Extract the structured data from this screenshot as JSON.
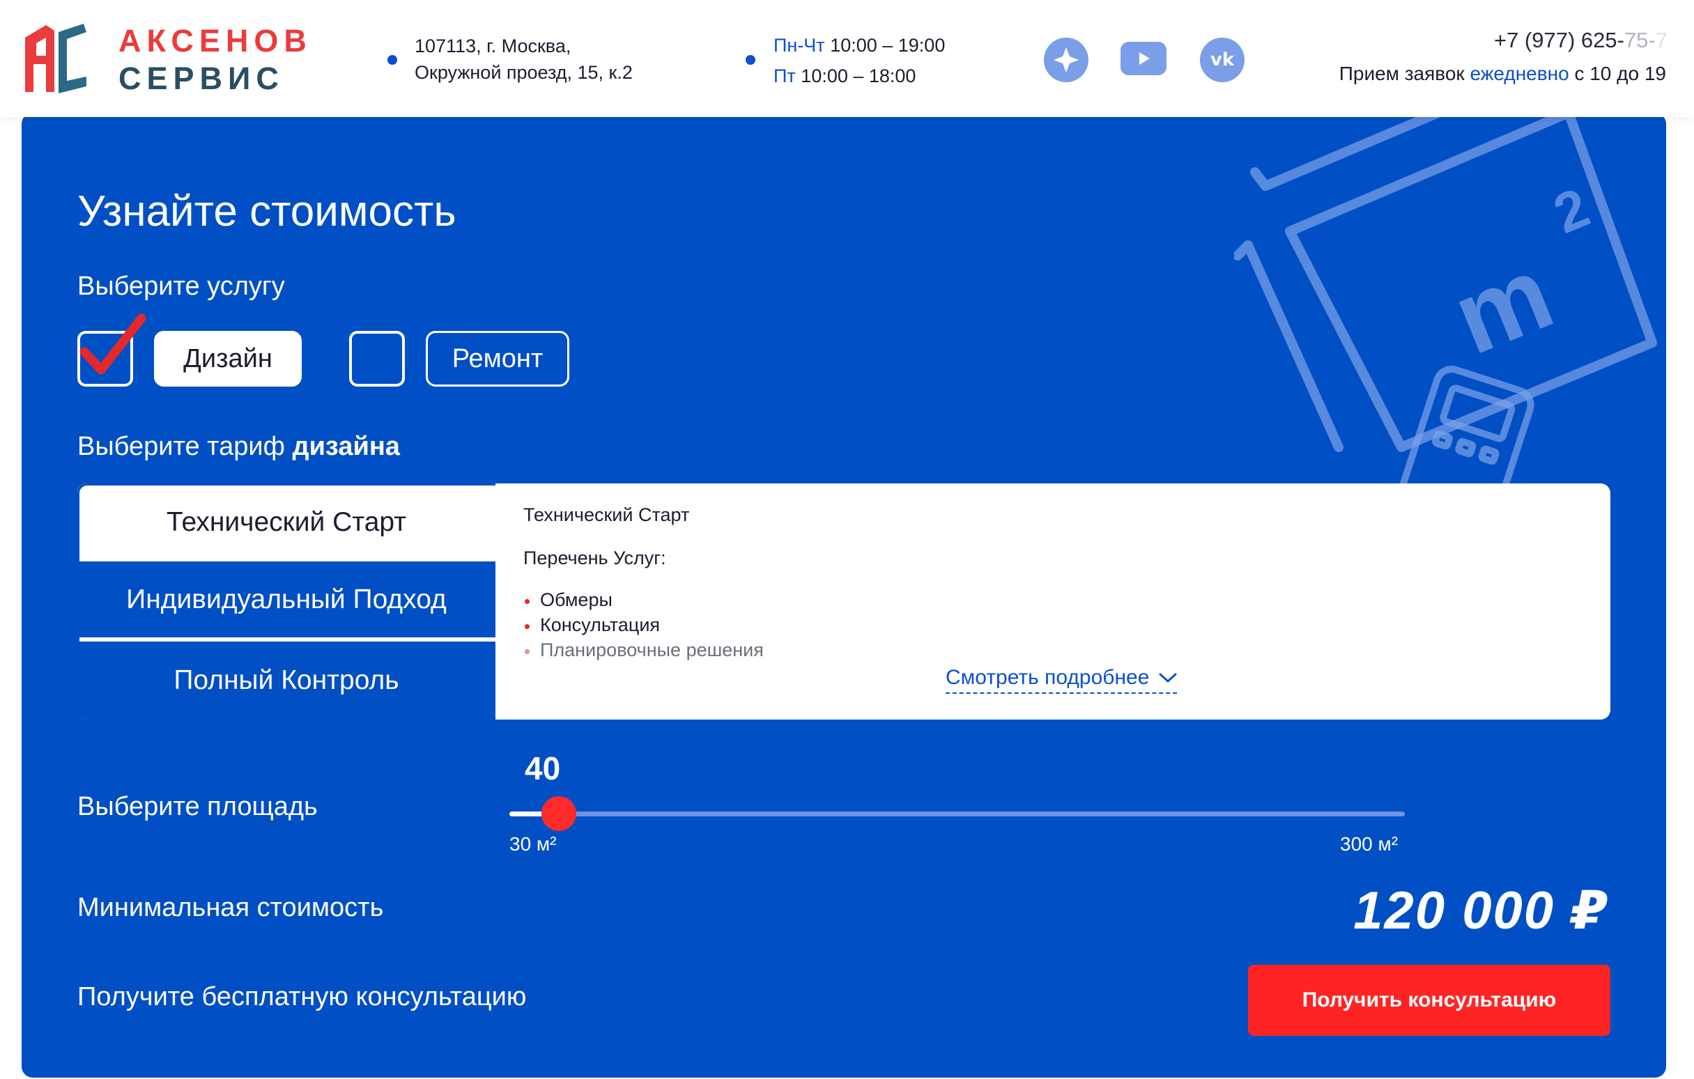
{
  "header": {
    "logo": {
      "line1": "АКСЕНОВ",
      "line2": "СЕРВИС"
    },
    "address": {
      "line1": "107113, г. Москва,",
      "line2": "Окружной проезд, 15, к.2"
    },
    "hours": {
      "row1_days": "Пн-Чт",
      "row1_time": "10:00 – 19:00",
      "row2_days": "Пт",
      "row2_time": "10:00 – 18:00"
    },
    "social": [
      "compass-icon",
      "youtube-icon",
      "vk-icon"
    ],
    "phone": {
      "main": "+7 (977) 625-",
      "fade": "75-",
      "fade2": "7"
    },
    "accept": {
      "pre": "Прием заявок ",
      "accent": "ежедневно",
      "post": " с 10 до 19"
    }
  },
  "calculator": {
    "title": "Узнайте стоимость",
    "service_label": "Выберите услугу",
    "services": [
      {
        "label": "Дизайн",
        "checked": true
      },
      {
        "label": "Ремонт",
        "checked": false
      }
    ],
    "tariff_label_pre": "Выберите тариф ",
    "tariff_label_bold": "дизайна",
    "tabs": [
      "Технический Старт",
      "Индивидуальный Подход",
      "Полный Контроль"
    ],
    "active_tab": 0,
    "description": {
      "title": "Технический Старт",
      "subtitle": "Перечень Услуг:",
      "items": [
        "Обмеры",
        "Консультация",
        "Планировочные решения"
      ],
      "more_link": "Смотреть подробнее"
    },
    "area": {
      "label": "Выберите площадь",
      "value": "40",
      "min": "30 м²",
      "max": "300 м²",
      "fraction": 0.037
    },
    "min_cost_label": "Минимальная стоимость",
    "price": "120 000 ₽",
    "consult_label": "Получите бесплатную консультацию",
    "cta": "Получить консультацию"
  },
  "colors": {
    "brand_blue": "#004fc4",
    "accent_red": "#ff2424",
    "logo_red": "#ea3c3c",
    "logo_dark": "#2a4e63"
  }
}
